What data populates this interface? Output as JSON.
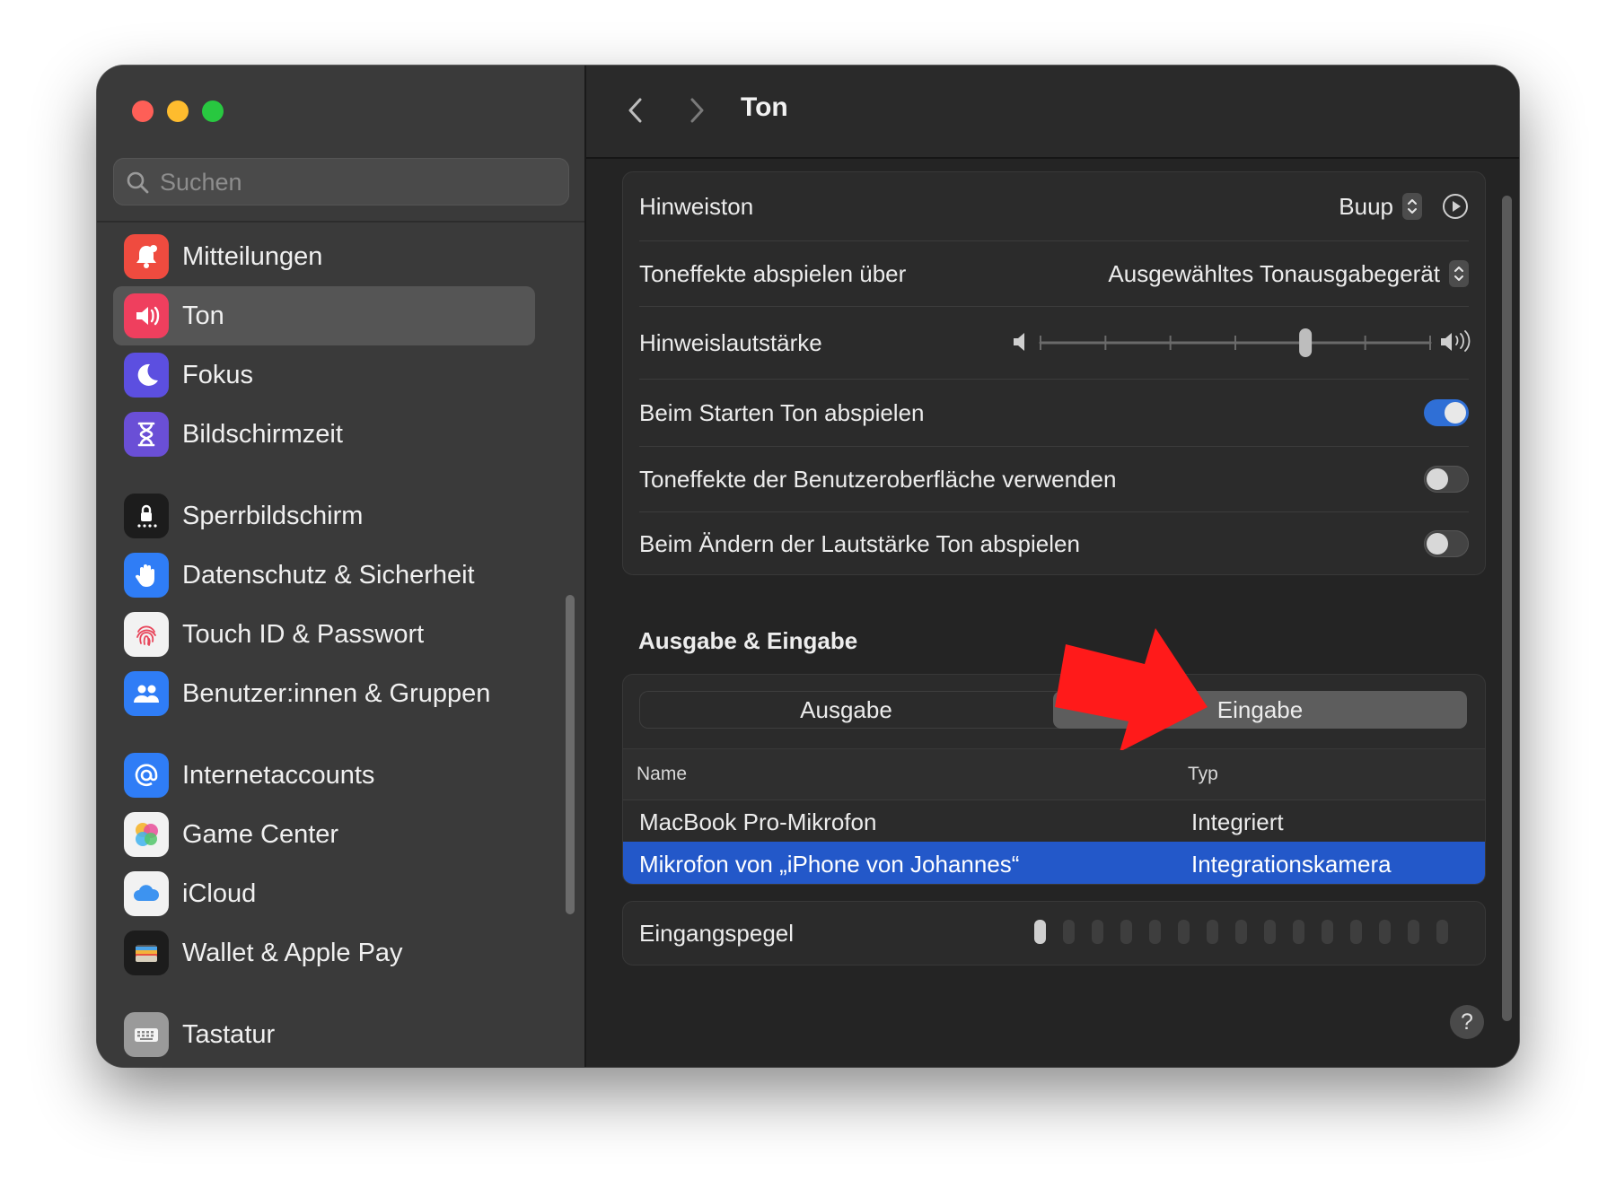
{
  "window": {
    "title": "Ton"
  },
  "sidebar": {
    "search_placeholder": "Suchen",
    "items": [
      {
        "label": "Mitteilungen",
        "icon": "bell-icon",
        "color": "#ef4b3f"
      },
      {
        "label": "Ton",
        "icon": "speaker-icon",
        "color": "#ef3f5e",
        "selected": true
      },
      {
        "label": "Fokus",
        "icon": "moon-icon",
        "color": "#5c4fe0"
      },
      {
        "label": "Bildschirmzeit",
        "icon": "hourglass-icon",
        "color": "#6a4fd6"
      },
      {
        "label": "Sperrbildschirm",
        "icon": "lock-screen-icon",
        "color": "#1c1c1c"
      },
      {
        "label": "Datenschutz & Sicherheit",
        "icon": "hand-icon",
        "color": "#2f7df6"
      },
      {
        "label": "Touch ID & Passwort",
        "icon": "fingerprint-icon",
        "color": "#f2f2f2"
      },
      {
        "label": "Benutzer:innen & Gruppen",
        "icon": "users-icon",
        "color": "#2f7df6"
      },
      {
        "label": "Internetaccounts",
        "icon": "at-icon",
        "color": "#2f7df6"
      },
      {
        "label": "Game Center",
        "icon": "game-center-icon",
        "color": "#f2f2f2"
      },
      {
        "label": "iCloud",
        "icon": "cloud-icon",
        "color": "#f2f2f2"
      },
      {
        "label": "Wallet & Apple Pay",
        "icon": "wallet-icon",
        "color": "#1c1c1c"
      },
      {
        "label": "Tastatur",
        "icon": "keyboard-icon",
        "color": "#9a9a9a"
      }
    ]
  },
  "sound": {
    "alert_sound_label": "Hinweiston",
    "alert_sound_value": "Buup",
    "effects_device_label": "Toneffekte abspielen über",
    "effects_device_value": "Ausgewähltes Tonausgabegerät",
    "alert_volume_label": "Hinweislautstärke",
    "alert_volume_level": 0.68,
    "startup_label": "Beim Starten Ton abspielen",
    "startup_on": true,
    "ui_effects_label": "Toneffekte der Benutzeroberfläche verwenden",
    "ui_effects_on": false,
    "volume_feedback_label": "Beim Ändern der Lautstärke Ton abspielen",
    "volume_feedback_on": false
  },
  "io": {
    "section_title": "Ausgabe & Eingabe",
    "tabs": [
      "Ausgabe",
      "Eingabe"
    ],
    "active_tab": "Eingabe",
    "columns": {
      "name": "Name",
      "type": "Typ"
    },
    "devices": [
      {
        "name": "MacBook Pro-Mikrofon",
        "type": "Integriert",
        "selected": false
      },
      {
        "name": "Mikrofon von „iPhone von Johannes“",
        "type": "Integrationskamera",
        "selected": true
      }
    ],
    "input_level_label": "Eingangspegel",
    "input_level_lit": 1,
    "input_level_total": 15
  },
  "help_label": "?",
  "colors": {
    "accent": "#2f6fd6",
    "selection": "#2358c9",
    "annotation_arrow": "#ff1a1a"
  }
}
